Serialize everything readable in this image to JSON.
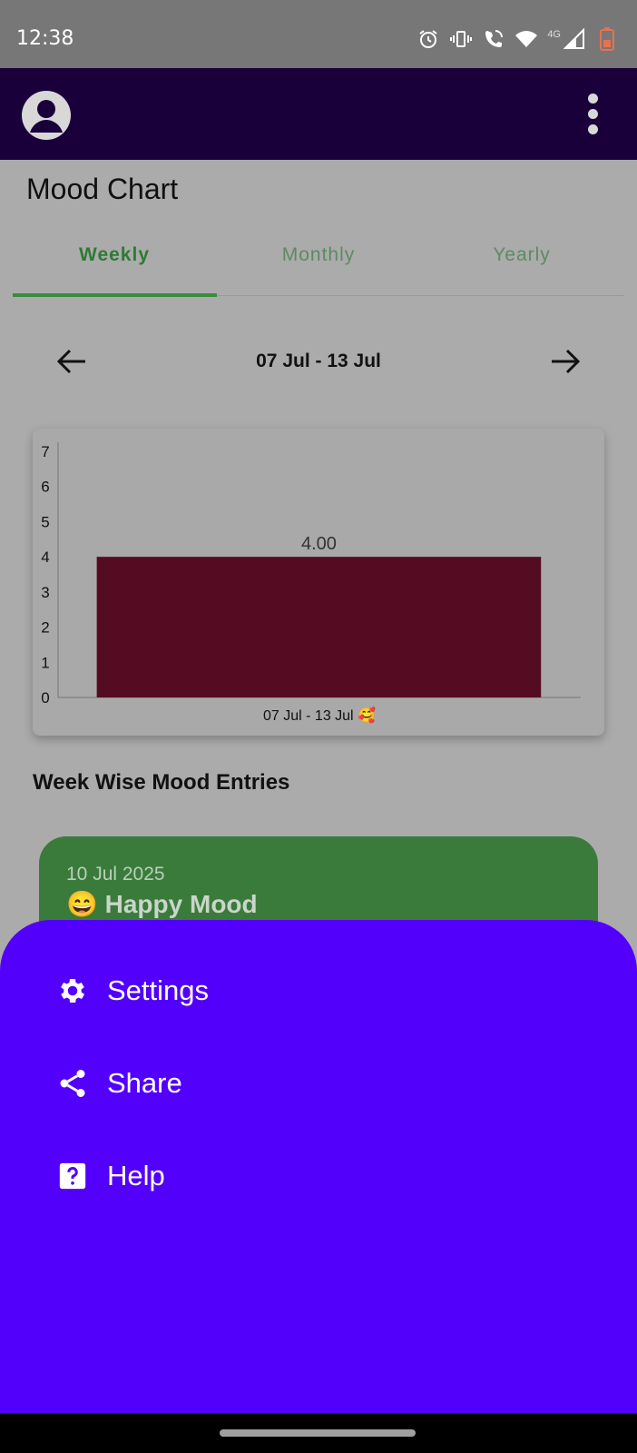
{
  "status_bar": {
    "time": "12:38",
    "icons": [
      "alarm-icon",
      "vibrate-icon",
      "wifi-call-icon",
      "wifi-icon",
      "signal-icon",
      "battery-icon"
    ],
    "network": "4G"
  },
  "app_bar": {
    "color": "#1a003a"
  },
  "page": {
    "title": "Mood Chart"
  },
  "tabs": [
    {
      "label": "Weekly",
      "active": true
    },
    {
      "label": "Monthly",
      "active": false
    },
    {
      "label": "Yearly",
      "active": false
    }
  ],
  "range_nav": {
    "label": "07 Jul - 13 Jul"
  },
  "chart_data": {
    "type": "bar",
    "categories": [
      "07 Jul - 13 Jul 🥰"
    ],
    "values": [
      4.0
    ],
    "value_labels": [
      "4.00"
    ],
    "ylim": [
      0,
      7
    ],
    "y_ticks": [
      "0",
      "1",
      "2",
      "3",
      "4",
      "5",
      "6",
      "7"
    ],
    "bar_color": "#550c22",
    "grid": false
  },
  "entries_section": {
    "title": "Week Wise Mood Entries",
    "entries": [
      {
        "date": "10 Jul 2025",
        "mood": "😄 Happy Mood",
        "color": "#3a7b3c"
      }
    ]
  },
  "bottom_sheet": {
    "color": "#5200fb",
    "items": [
      {
        "label": "Settings",
        "icon": "gear-icon"
      },
      {
        "label": "Share",
        "icon": "share-icon"
      },
      {
        "label": "Help",
        "icon": "help-icon"
      }
    ]
  }
}
